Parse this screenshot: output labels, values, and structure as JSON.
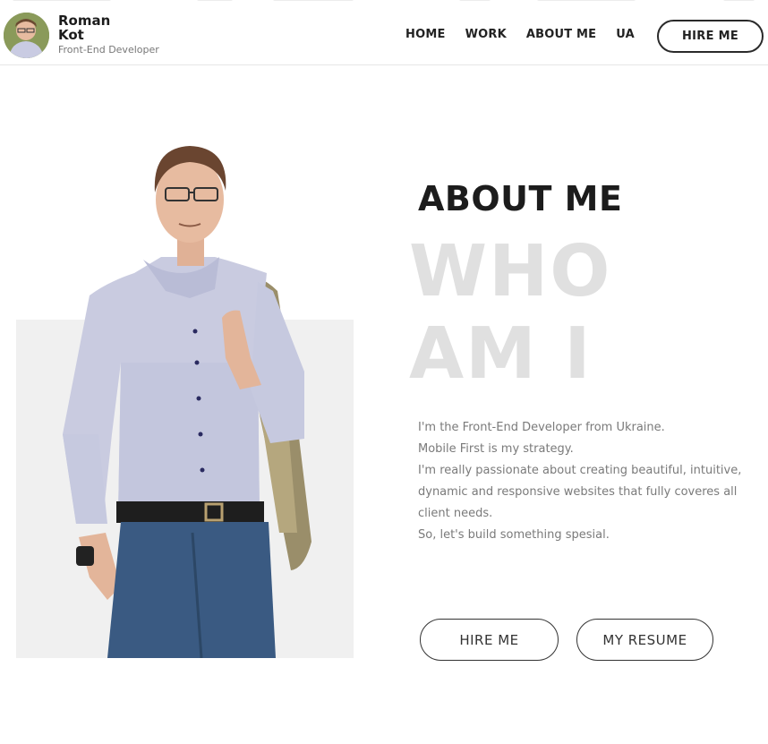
{
  "header": {
    "name": "Roman Kot",
    "role": "Front-End Developer",
    "nav": [
      "HOME",
      "WORK",
      "ABOUT ME",
      "UA"
    ],
    "hire_label": "HIRE ME"
  },
  "about": {
    "heading": "ABOUT ME",
    "ghost_line1": "WHO",
    "ghost_line2": "AM I",
    "lines": [
      "I'm the Front-End Developer from Ukraine.",
      "Mobile First is my strategy.",
      "I'm really passionate about creating beautiful, intuitive, dynamic and responsive websites that fully coveres all client needs.",
      "So, let's build something spesial."
    ],
    "hire_label": "HIRE ME",
    "resume_label": "MY RESUME"
  },
  "colors": {
    "text": "#1c1c1c",
    "muted": "#7a7a7a",
    "ghost": "#e0e0e0",
    "photo_bg": "#f0f0f0"
  }
}
